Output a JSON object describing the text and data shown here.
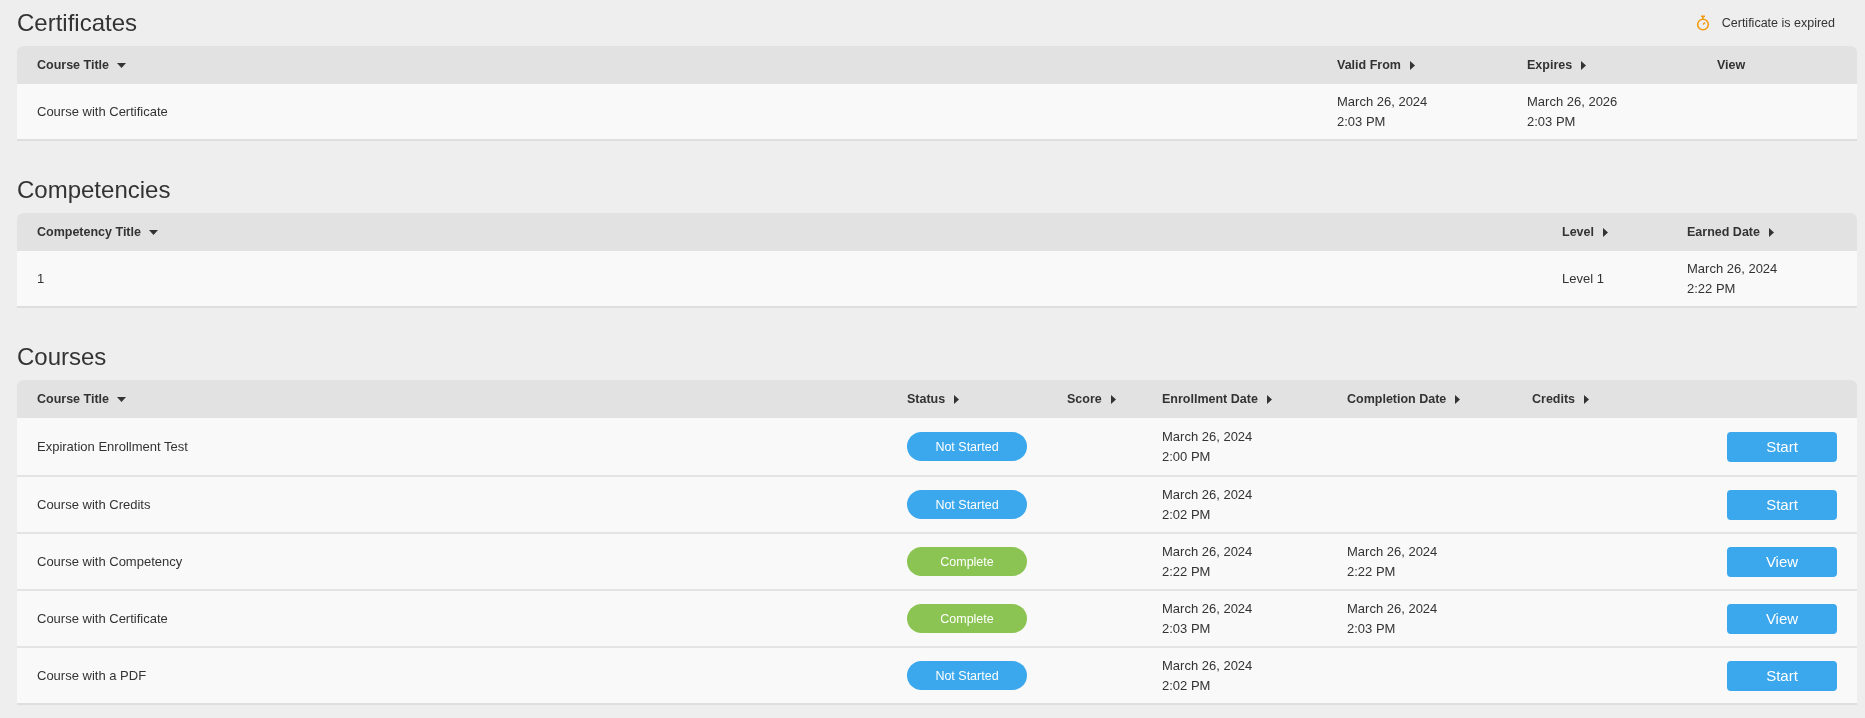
{
  "certificates": {
    "title": "Certificates",
    "legend": "Certificate is expired",
    "columns": [
      {
        "label": "Course Title",
        "sorted": true
      },
      {
        "label": "Valid From",
        "sorted": false
      },
      {
        "label": "Expires",
        "sorted": false
      },
      {
        "label": "View"
      }
    ],
    "rows": [
      {
        "cells": [
          "Course with Certificate",
          [
            "March 26, 2024",
            "2:03 PM"
          ],
          [
            "March 26, 2026",
            "2:03 PM"
          ],
          ""
        ]
      }
    ]
  },
  "competencies": {
    "title": "Competencies",
    "columns": [
      {
        "label": "Competency Title",
        "sorted": true
      },
      {
        "label": "Level",
        "sorted": false
      },
      {
        "label": "Earned Date",
        "sorted": false
      }
    ],
    "rows": [
      {
        "cells": [
          "1",
          "Level 1",
          [
            "March 26, 2024",
            "2:22 PM"
          ]
        ]
      }
    ]
  },
  "courses": {
    "title": "Courses",
    "columns": [
      {
        "label": "Course Title",
        "sorted": true
      },
      {
        "label": "Status",
        "sorted": false
      },
      {
        "label": "Score",
        "sorted": false
      },
      {
        "label": "Enrollment Date",
        "sorted": false
      },
      {
        "label": "Completion Date",
        "sorted": false
      },
      {
        "label": "Credits",
        "sorted": false
      }
    ],
    "rows": [
      {
        "title": "Expiration Enrollment Test",
        "status": {
          "text": "Not Started",
          "kind": "not_started"
        },
        "enrollment": [
          "March 26, 2024",
          "2:00 PM"
        ],
        "action": "Start"
      },
      {
        "title": "Course with Credits",
        "status": {
          "text": "Not Started",
          "kind": "not_started"
        },
        "enrollment": [
          "March 26, 2024",
          "2:02 PM"
        ],
        "action": "Start"
      },
      {
        "title": "Course with Competency",
        "status": {
          "text": "Complete",
          "kind": "complete"
        },
        "enrollment": [
          "March 26, 2024",
          "2:22 PM"
        ],
        "completion": [
          "March 26, 2024",
          "2:22 PM"
        ],
        "action": "View"
      },
      {
        "title": "Course with Certificate",
        "status": {
          "text": "Complete",
          "kind": "complete"
        },
        "enrollment": [
          "March 26, 2024",
          "2:03 PM"
        ],
        "completion": [
          "March 26, 2024",
          "2:03 PM"
        ],
        "action": "View"
      },
      {
        "title": "Course with a PDF",
        "status": {
          "text": "Not Started",
          "kind": "not_started"
        },
        "enrollment": [
          "March 26, 2024",
          "2:02 PM"
        ],
        "action": "Start"
      }
    ]
  }
}
